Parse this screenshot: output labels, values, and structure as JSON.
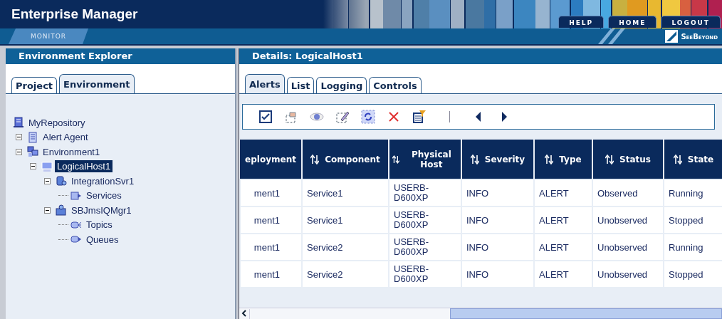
{
  "app": {
    "title": "Enterprise Manager",
    "nav_tab": "MONITOR",
    "top_links": [
      "HELP",
      "HOME",
      "LOGOUT"
    ],
    "logo": "SeeBeyond"
  },
  "explorer": {
    "title": "Environment Explorer",
    "tabs": [
      {
        "label": "Project",
        "selected": false
      },
      {
        "label": "Environment",
        "selected": true
      }
    ],
    "tree": [
      {
        "label": "MyRepository",
        "kind": "repository",
        "selected": false,
        "children": [
          {
            "label": "Alert Agent",
            "kind": "agent",
            "selected": false,
            "expanded": true
          },
          {
            "label": "Environment1",
            "kind": "environment",
            "selected": false,
            "expanded": true,
            "children": [
              {
                "label": "LogicalHost1",
                "kind": "host",
                "selected": true,
                "expanded": true,
                "children": [
                  {
                    "label": "IntegrationSvr1",
                    "kind": "server",
                    "selected": false,
                    "expanded": true,
                    "children": [
                      {
                        "label": "Services",
                        "kind": "services",
                        "selected": false
                      }
                    ]
                  },
                  {
                    "label": "SBJmsIQMgr1",
                    "kind": "mqmgr",
                    "selected": false,
                    "expanded": true,
                    "children": [
                      {
                        "label": "Topics",
                        "kind": "topics",
                        "selected": false
                      },
                      {
                        "label": "Queues",
                        "kind": "queues",
                        "selected": false
                      }
                    ]
                  }
                ]
              }
            ]
          }
        ]
      }
    ]
  },
  "details": {
    "title": "Details: LogicalHost1",
    "tabs": [
      {
        "label": "Alerts",
        "selected": true
      },
      {
        "label": "List",
        "selected": false
      },
      {
        "label": "Logging",
        "selected": false
      },
      {
        "label": "Controls",
        "selected": false
      }
    ],
    "table": {
      "columns": [
        {
          "label": "eployment",
          "sortable": false
        },
        {
          "label": "Component",
          "sortable": true
        },
        {
          "label": "Physical Host",
          "sortable": true
        },
        {
          "label": "Severity",
          "sortable": true
        },
        {
          "label": "Type",
          "sortable": true
        },
        {
          "label": "Status",
          "sortable": true
        },
        {
          "label": "State",
          "sortable": true
        }
      ],
      "rows": [
        [
          "ment1",
          "Service1",
          "USERB-D600XP",
          "INFO",
          "ALERT",
          "Observed",
          "Running"
        ],
        [
          "ment1",
          "Service1",
          "USERB-D600XP",
          "INFO",
          "ALERT",
          "Unobserved",
          "Stopped"
        ],
        [
          "ment1",
          "Service2",
          "USERB-D600XP",
          "INFO",
          "ALERT",
          "Unobserved",
          "Running"
        ],
        [
          "ment1",
          "Service2",
          "USERB-D600XP",
          "INFO",
          "ALERT",
          "Unobserved",
          "Stopped"
        ]
      ]
    }
  }
}
